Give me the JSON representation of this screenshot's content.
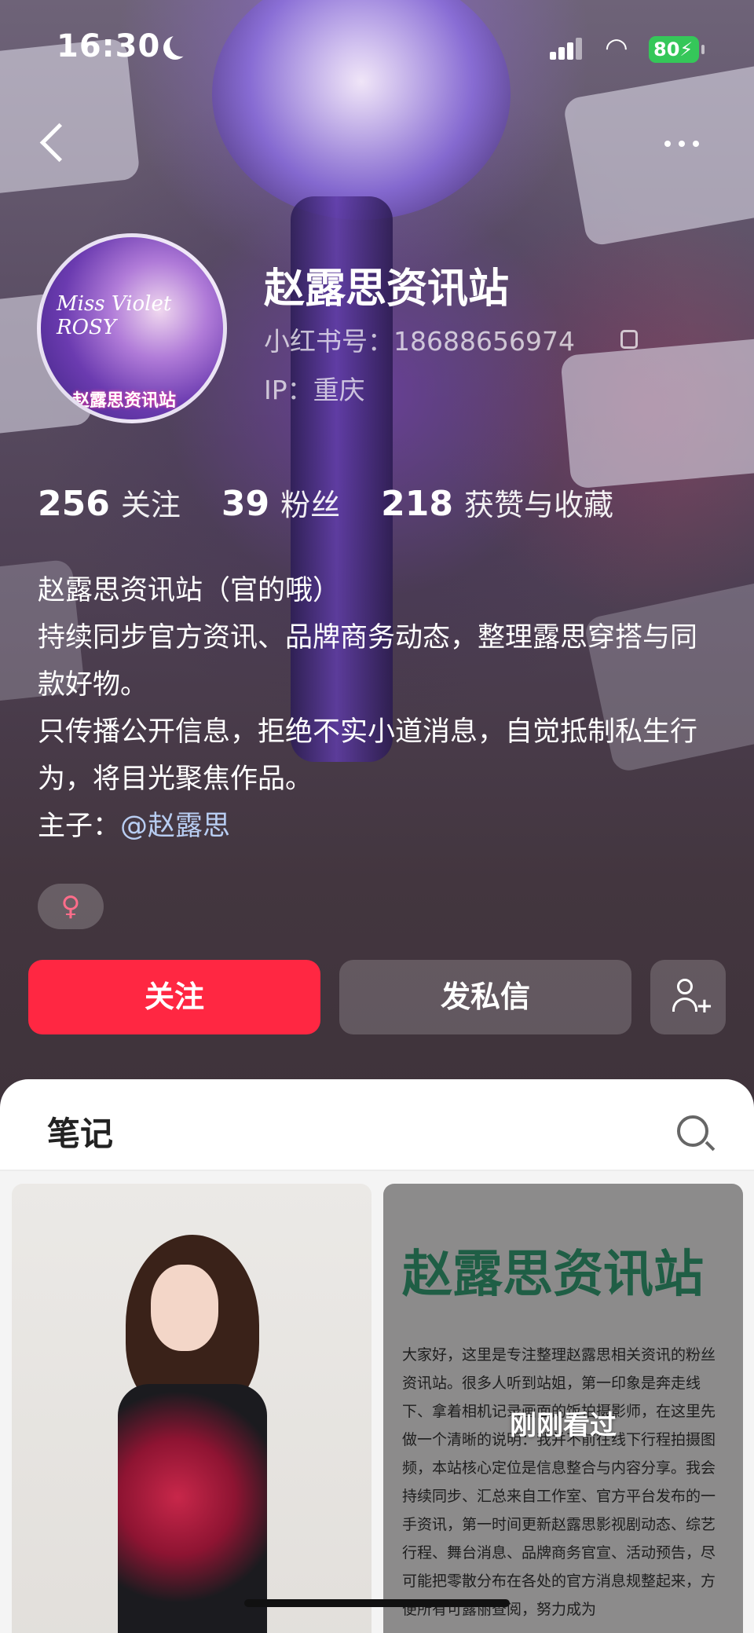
{
  "status_bar": {
    "time": "16:30",
    "battery": "80"
  },
  "profile": {
    "nickname": "赵露思资讯站",
    "red_id": "小红书号：18688656974",
    "ip": "IP：重庆",
    "avatar_text": "赵露思资讯站",
    "avatar_script": "Miss Violet ROSY"
  },
  "stats": [
    {
      "num": "256",
      "label": "关注"
    },
    {
      "num": "39",
      "label": "粉丝"
    },
    {
      "num": "218",
      "label": "获赞与收藏"
    }
  ],
  "bio": {
    "line1": "赵露思资讯站（官的哦）",
    "line2": "持续同步官方资讯、品牌商务动态，整理露思穿搭与同款好物。",
    "line3": "只传播公开信息，拒绝不实小道消息，自觉抵制私生行为，将目光聚焦作品。",
    "owner_prefix": "主子：",
    "owner_mention": "@赵露思"
  },
  "gender": "♀",
  "buttons": {
    "follow": "关注",
    "message": "发私信"
  },
  "notes": {
    "tab_title": "笔记",
    "right_card": {
      "title": "赵露思资讯站",
      "body": "大家好，这里是专注整理赵露思相关资讯的粉丝资讯站。很多人听到站姐，第一印象是奔走线下、拿着相机记录画面的饭拍摄影师，在这里先做一个清晰的说明：我并不前往线下行程拍摄图频，本站核心定位是信息整合与内容分享。我会持续同步、汇总来自工作室、官方平台发布的一手资讯，第一时间更新赵露思影视剧动态、综艺行程、舞台消息、品牌商务官宣、活动预告，尽可能把零散分布在各处的官方消息规整起来，方便所有可露丽查阅，努力成为",
      "badge": "刚刚看过"
    }
  },
  "colors": {
    "accent": "#ff2742",
    "mention": "#b8cdf2",
    "gender": "#ff6d8a"
  }
}
